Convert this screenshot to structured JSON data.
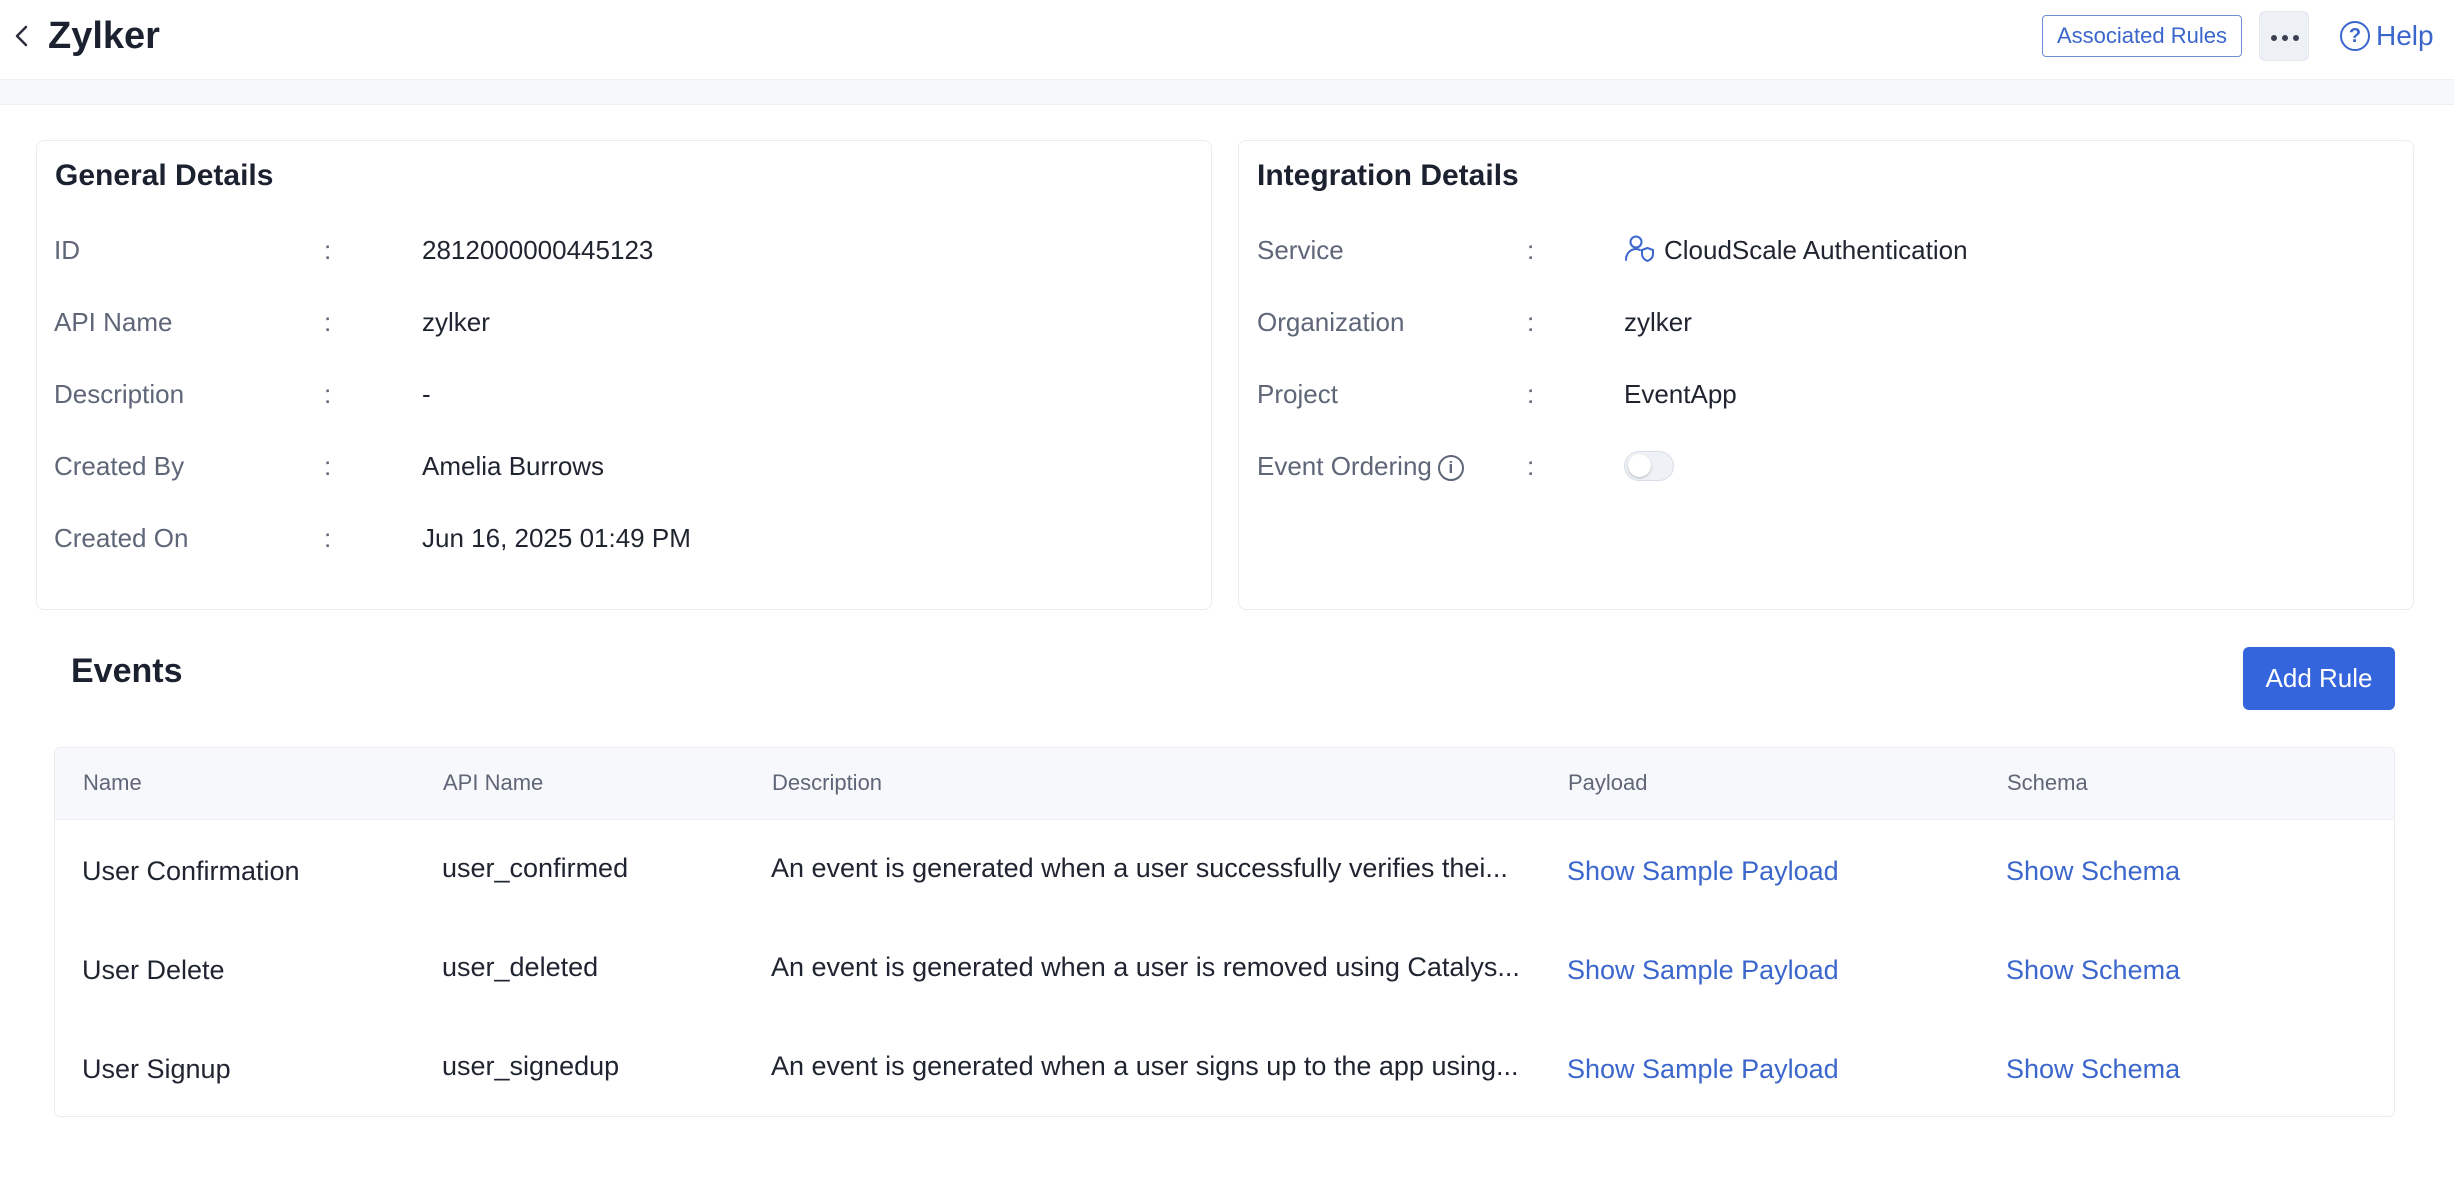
{
  "header": {
    "title": "Zylker",
    "associated_rules_label": "Associated Rules",
    "help_label": "Help"
  },
  "general": {
    "title": "General Details",
    "fields": [
      {
        "label": "ID",
        "value": "2812000000445123"
      },
      {
        "label": "API Name",
        "value": "zylker"
      },
      {
        "label": "Description",
        "value": "-"
      },
      {
        "label": "Created By",
        "value": "Amelia Burrows"
      },
      {
        "label": "Created On",
        "value": "Jun 16, 2025 01:49 PM"
      }
    ]
  },
  "integration": {
    "title": "Integration Details",
    "service_label": "Service",
    "service_value": "CloudScale Authentication",
    "organization_label": "Organization",
    "organization_value": "zylker",
    "project_label": "Project",
    "project_value": "EventApp",
    "event_ordering_label": "Event Ordering",
    "event_ordering_enabled": false
  },
  "separator": ":",
  "events": {
    "title": "Events",
    "add_rule_label": "Add Rule",
    "columns": [
      "Name",
      "API Name",
      "Description",
      "Payload",
      "Schema"
    ],
    "rows": [
      {
        "name": "User Confirmation",
        "api_name": "user_confirmed",
        "description": "An event is generated when a user successfully verifies thei...",
        "payload": "Show Sample Payload",
        "schema": "Show Schema"
      },
      {
        "name": "User Delete",
        "api_name": "user_deleted",
        "description": "An event is generated when a user is removed using Catalys...",
        "payload": "Show Sample Payload",
        "schema": "Show Schema"
      },
      {
        "name": "User Signup",
        "api_name": "user_signedup",
        "description": "An event is generated when a user signs up to the app using...",
        "payload": "Show Sample Payload",
        "schema": "Show Schema"
      }
    ]
  },
  "colors": {
    "accent": "#3565dc",
    "link": "#3b66cc",
    "label": "#5e6678"
  }
}
